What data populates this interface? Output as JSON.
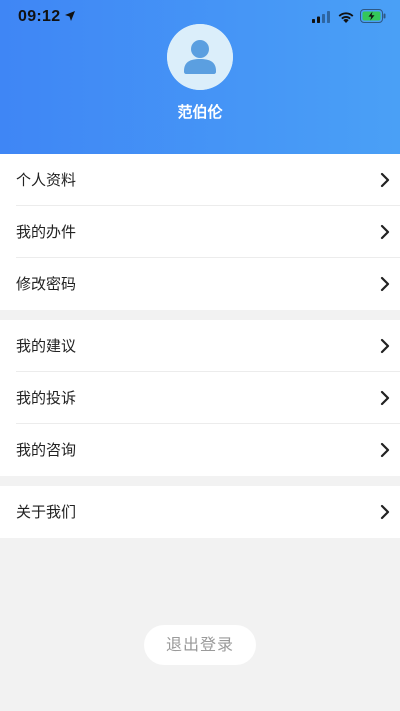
{
  "status_bar": {
    "time": "09:12",
    "icons": [
      "location-arrow-icon",
      "cellular-signal-icon",
      "wifi-icon",
      "battery-charging-icon"
    ]
  },
  "profile": {
    "username": "范伯伦",
    "avatar_icon": "user-avatar-icon"
  },
  "menu": {
    "group1": [
      {
        "label": "个人资料"
      },
      {
        "label": "我的办件"
      },
      {
        "label": "修改密码"
      }
    ],
    "group2": [
      {
        "label": "我的建议"
      },
      {
        "label": "我的投诉"
      },
      {
        "label": "我的咨询"
      }
    ],
    "group3": [
      {
        "label": "关于我们"
      }
    ]
  },
  "logout_label": "退出登录",
  "colors": {
    "header_gradient_start": "#3f86f5",
    "header_gradient_end": "#4aa0f6",
    "page_background": "#f2f2f2",
    "battery_green": "#34c759"
  }
}
